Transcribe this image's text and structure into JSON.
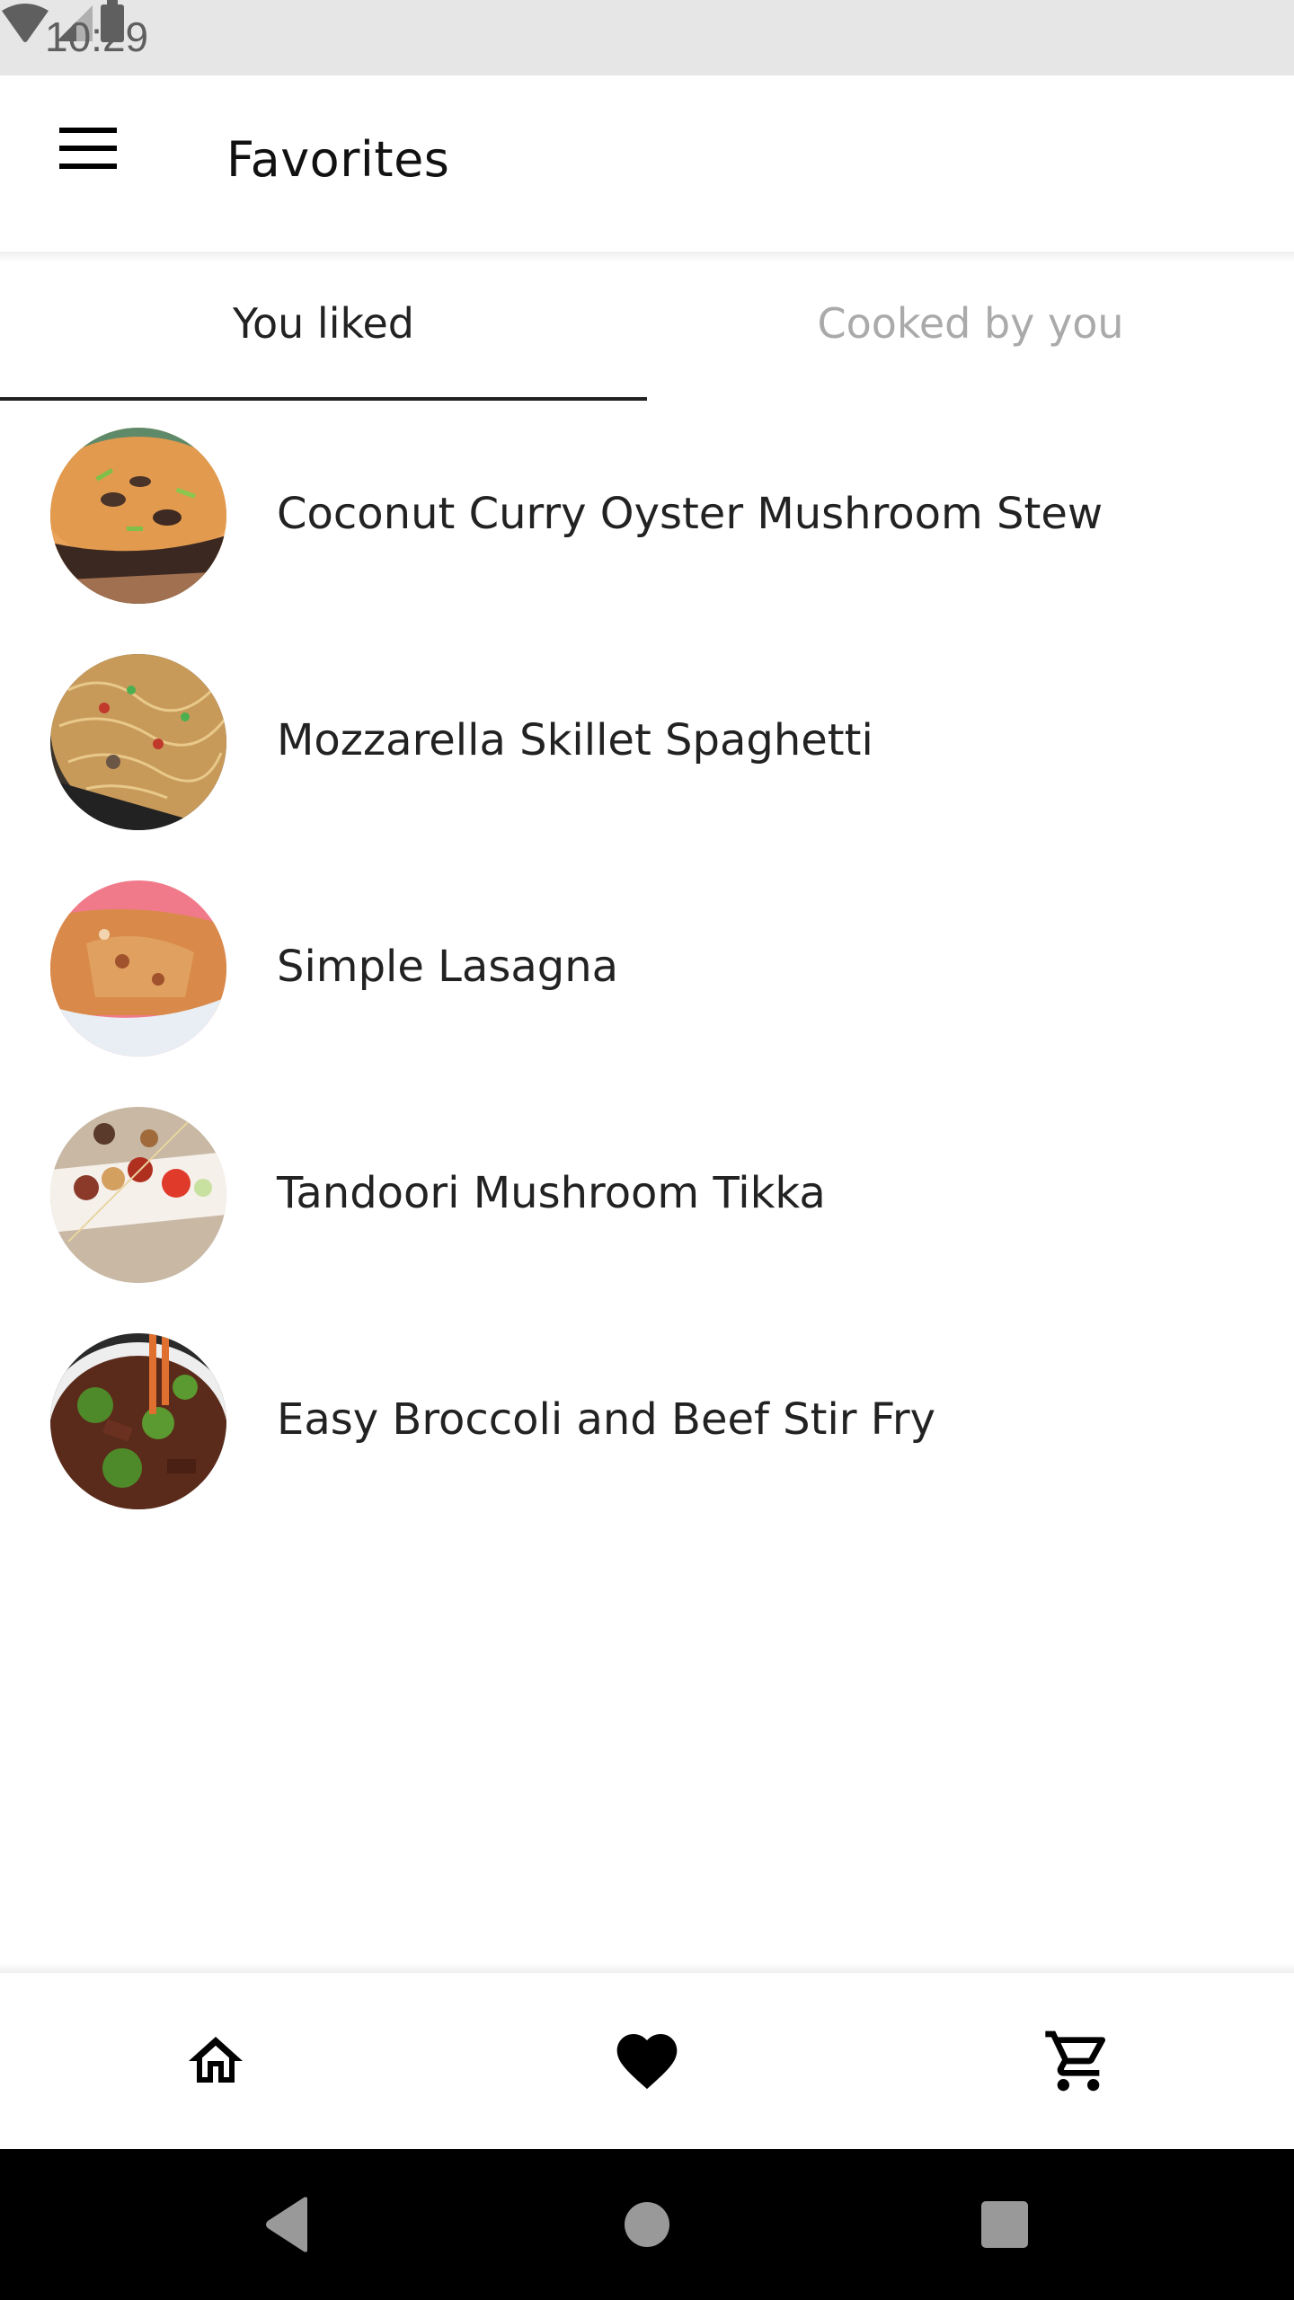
{
  "status_bar": {
    "time": "10:29",
    "icons": [
      "wifi-icon",
      "cell-signal-icon",
      "battery-icon"
    ]
  },
  "app_bar": {
    "title": "Favorites",
    "menu_icon": "hamburger-menu-icon"
  },
  "tabs": [
    {
      "label": "You liked",
      "active": true
    },
    {
      "label": "Cooked by you",
      "active": false
    }
  ],
  "favorites": [
    {
      "title": "Coconut Curry Oyster Mushroom Stew",
      "image": "curry-stew-photo"
    },
    {
      "title": "Mozzarella Skillet Spaghetti",
      "image": "skillet-spaghetti-photo"
    },
    {
      "title": "Simple Lasagna",
      "image": "lasagna-photo"
    },
    {
      "title": "Tandoori Mushroom Tikka",
      "image": "mushroom-tikka-photo"
    },
    {
      "title": "Easy Broccoli and Beef Stir Fry",
      "image": "beef-broccoli-photo"
    }
  ],
  "bottom_nav": [
    {
      "name": "home",
      "icon": "home-icon",
      "active": false
    },
    {
      "name": "favorites",
      "icon": "heart-icon",
      "active": true
    },
    {
      "name": "cart",
      "icon": "cart-icon",
      "active": false
    }
  ],
  "system_nav": [
    "back",
    "home",
    "recents"
  ],
  "colors": {
    "status_bar_bg": "#e6e6e6",
    "text_primary": "#222222",
    "tab_inactive": "#aaaaaa",
    "tab_indicator": "#222222",
    "system_nav_bg": "#000000",
    "system_nav_icons": "#999999"
  }
}
